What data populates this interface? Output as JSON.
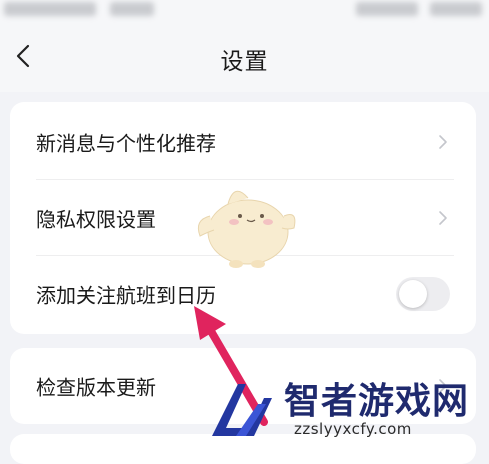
{
  "header": {
    "title": "设置"
  },
  "settings_group_1": [
    {
      "label": "新消息与个性化推荐",
      "control": "chevron"
    },
    {
      "label": "隐私权限设置",
      "control": "chevron"
    },
    {
      "label": "添加关注航班到日历",
      "control": "toggle",
      "enabled": false
    }
  ],
  "settings_group_2": [
    {
      "label": "检查版本更新",
      "control": "chevron"
    }
  ],
  "icons": {
    "back": "chevron-left-icon",
    "row_arrow": "chevron-right-icon"
  },
  "watermark": {
    "name": "智者游戏网",
    "url": "zzslyyxcfy.com"
  },
  "colors": {
    "background": "#f2f3f7",
    "card": "#ffffff",
    "toggle_off": "#ededf0",
    "annotation_arrow": "#e0245e",
    "watermark_text": "#1f2a6e"
  }
}
